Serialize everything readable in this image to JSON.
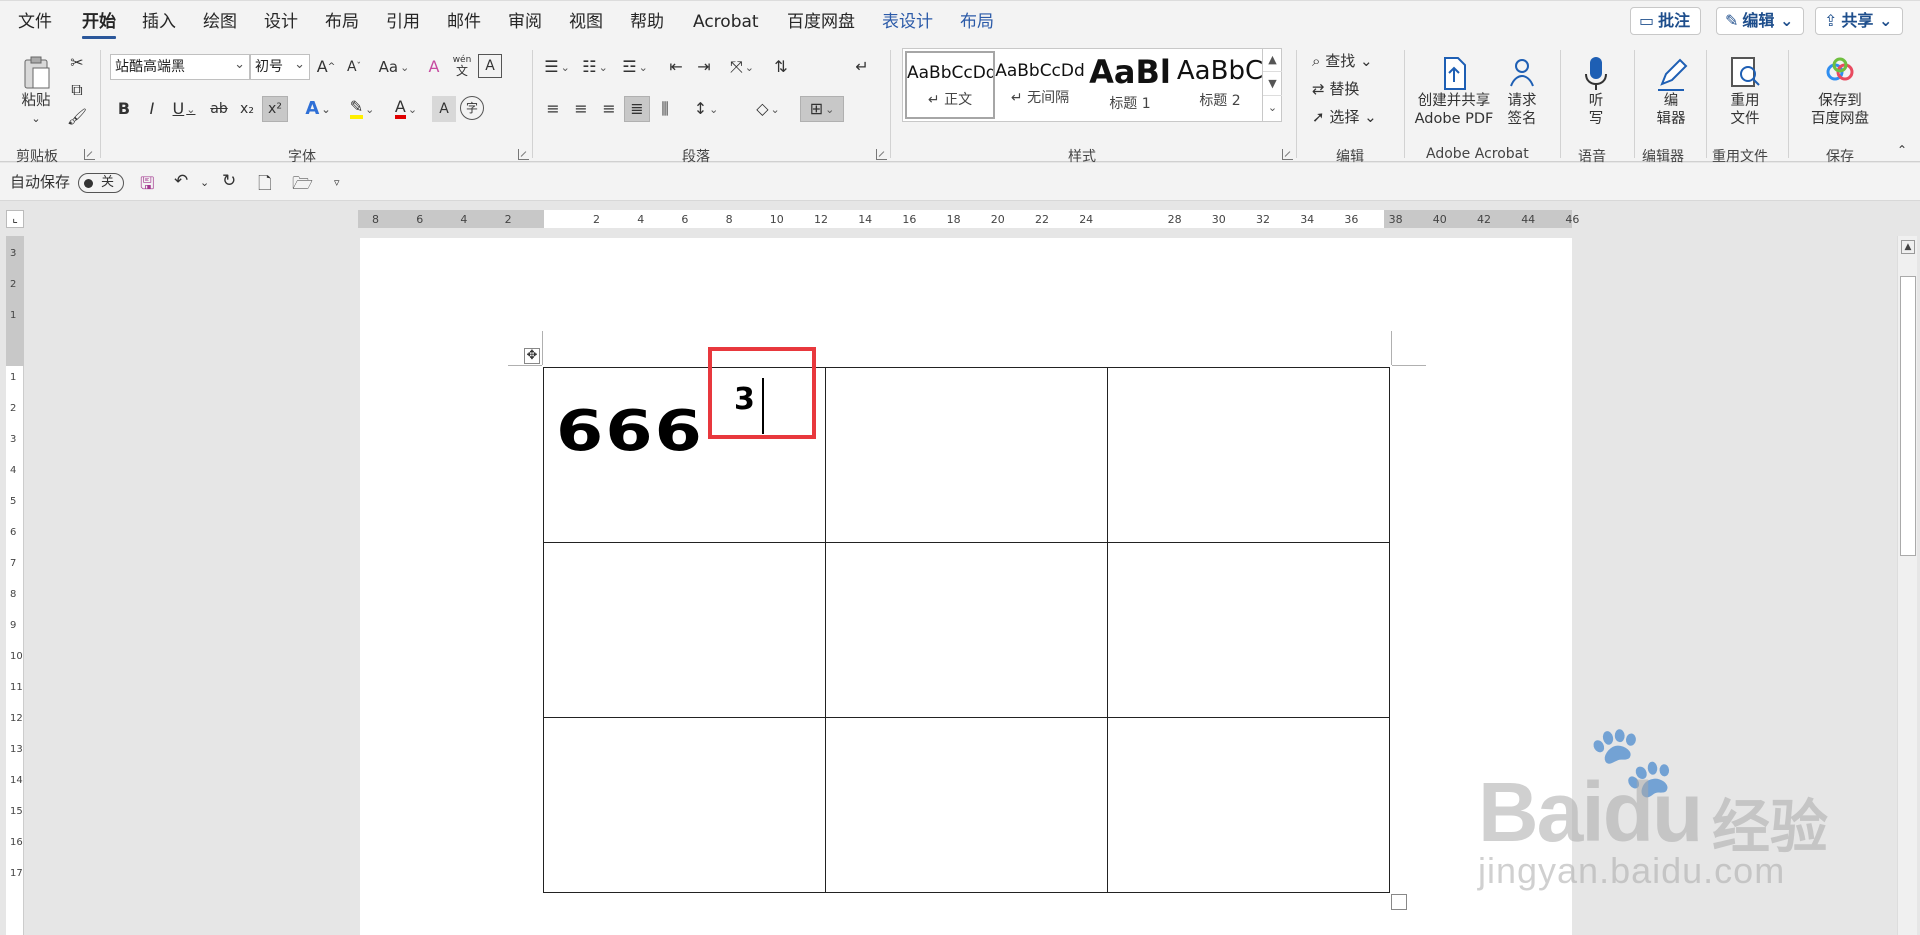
{
  "menu": {
    "tabs": [
      {
        "label": "文件"
      },
      {
        "label": "开始"
      },
      {
        "label": "插入"
      },
      {
        "label": "绘图"
      },
      {
        "label": "设计"
      },
      {
        "label": "布局"
      },
      {
        "label": "引用"
      },
      {
        "label": "邮件"
      },
      {
        "label": "审阅"
      },
      {
        "label": "视图"
      },
      {
        "label": "帮助"
      },
      {
        "label": "Acrobat"
      },
      {
        "label": "百度网盘"
      },
      {
        "label": "表设计"
      },
      {
        "label": "布局"
      }
    ],
    "active_tab": "开始",
    "right_buttons": {
      "comment": "批注",
      "edit": "编辑",
      "share": "共享"
    }
  },
  "ribbon": {
    "clipboard": {
      "paste": "粘贴",
      "label": "剪贴板"
    },
    "font": {
      "name": "站酷高端黑",
      "size": "初号",
      "aa_label": "Aa",
      "wen_label": "wén",
      "wen_sub": "文",
      "label": "字体",
      "bold": "B",
      "italic": "I",
      "underline": "U",
      "strike": "ab",
      "sub": "x₂",
      "sup": "x²",
      "char_shade": "A",
      "enclose": "字"
    },
    "paragraph": {
      "label": "段落"
    },
    "styles": {
      "items": [
        {
          "preview": "AaBbCcDd",
          "name": "↵ 正文"
        },
        {
          "preview": "AaBbCcDd",
          "name": "↵ 无间隔"
        },
        {
          "preview": "AaBl",
          "name": "标题 1"
        },
        {
          "preview": "AaBbC",
          "name": "标题 2"
        }
      ],
      "label": "样式"
    },
    "editing": {
      "find": "查找",
      "replace": "替换",
      "select": "选择",
      "label": "编辑"
    },
    "adobe": {
      "create_line1": "创建并共享",
      "create_line2": "Adobe PDF",
      "sign_line1": "请求",
      "sign_line2": "签名",
      "label": "Adobe Acrobat"
    },
    "voice": {
      "dictate_line1": "听",
      "dictate_line2": "写",
      "label": "语音"
    },
    "editor": {
      "btn_line1": "编",
      "btn_line2": "辑器",
      "label": "编辑器"
    },
    "reuse": {
      "btn_line1": "重用",
      "btn_line2": "文件",
      "label": "重用文件"
    },
    "save": {
      "btn_line1": "保存到",
      "btn_line2": "百度网盘",
      "label": "保存"
    }
  },
  "qat": {
    "autosave": "自动保存",
    "toggle": "关"
  },
  "ruler": {
    "h_ticks": [
      "8",
      "6",
      "4",
      "2",
      "",
      "2",
      "4",
      "6",
      "8",
      "10",
      "12",
      "14",
      "16",
      "18",
      "20",
      "22",
      "24",
      "",
      "28",
      "30",
      "32",
      "34",
      "36",
      "38",
      "40",
      "42",
      "44",
      "46"
    ],
    "v_ticks": [
      "3",
      "2",
      "1",
      "",
      "1",
      "2",
      "3",
      "4",
      "5",
      "6",
      "7",
      "8",
      "9",
      "10",
      "11",
      "12",
      "13",
      "14",
      "15",
      "16",
      "17"
    ]
  },
  "document": {
    "cell_text": "666",
    "superscript": "3"
  },
  "watermark": {
    "brand": "Baidu",
    "cn": "经验",
    "url": "jingyan.baidu.com"
  },
  "colors": {
    "accent": "#2b579a",
    "highlight_box": "#e8383d",
    "context_tab": "#2b5aa8"
  }
}
